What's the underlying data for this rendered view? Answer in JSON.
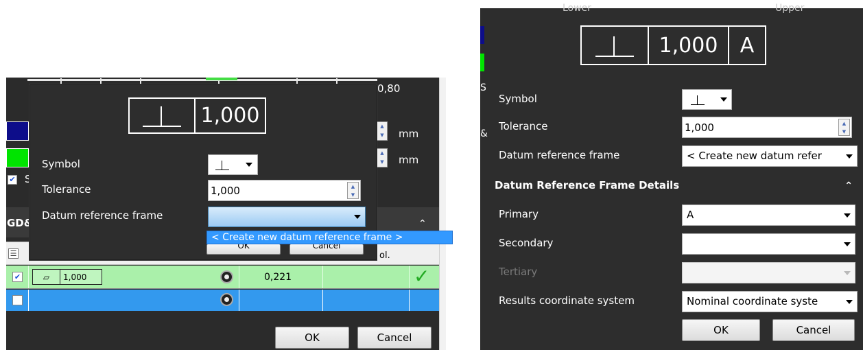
{
  "left": {
    "ruler_value": "0,80",
    "unit_1": "mm",
    "unit_2": "mm",
    "side_letter": "S",
    "section_label": "GD&",
    "header_partial": "ol.",
    "dialog": {
      "fcf_tolerance": "1,000",
      "symbol_label": "Symbol",
      "tolerance_label": "Tolerance",
      "tolerance_value": "1,000",
      "datum_frame_label": "Datum reference frame",
      "datum_frame_value": "",
      "dropdown_option": "< Create new datum reference frame >",
      "ok_partial": "OK",
      "cancel_partial": "Cancel"
    },
    "rows": [
      {
        "fcf_tol": "1,000",
        "value": "0,221",
        "checked": true,
        "status": "✓"
      },
      {
        "fcf_tol": "",
        "value": "",
        "checked": false,
        "status": ""
      }
    ],
    "ok_label": "OK",
    "cancel_label": "Cancel"
  },
  "right": {
    "top_left_text": "Lower",
    "top_right_text": "Upper",
    "side_letter": "S",
    "side_letter_2": "&",
    "fcf_tolerance": "1,000",
    "fcf_datum": "A",
    "symbol_label": "Symbol",
    "tolerance_label": "Tolerance",
    "tolerance_value": "1,000",
    "datum_frame_label": "Datum reference frame",
    "datum_frame_value": "< Create new datum refer",
    "details_title": "Datum Reference Frame Details",
    "primary_label": "Primary",
    "primary_value": "A",
    "secondary_label": "Secondary",
    "secondary_value": "",
    "tertiary_label": "Tertiary",
    "tertiary_value": "",
    "results_cs_label": "Results coordinate system",
    "results_cs_value": "Nominal coordinate syste",
    "ok_label": "OK",
    "cancel_label": "Cancel"
  },
  "colors": {
    "panel_dark": "#2d2d2d",
    "row_green": "#aaf0aa",
    "row_blue": "#3399ee",
    "swatch_blue": "#0d0d8a",
    "swatch_green": "#00e400",
    "check_green": "#22aa22"
  }
}
